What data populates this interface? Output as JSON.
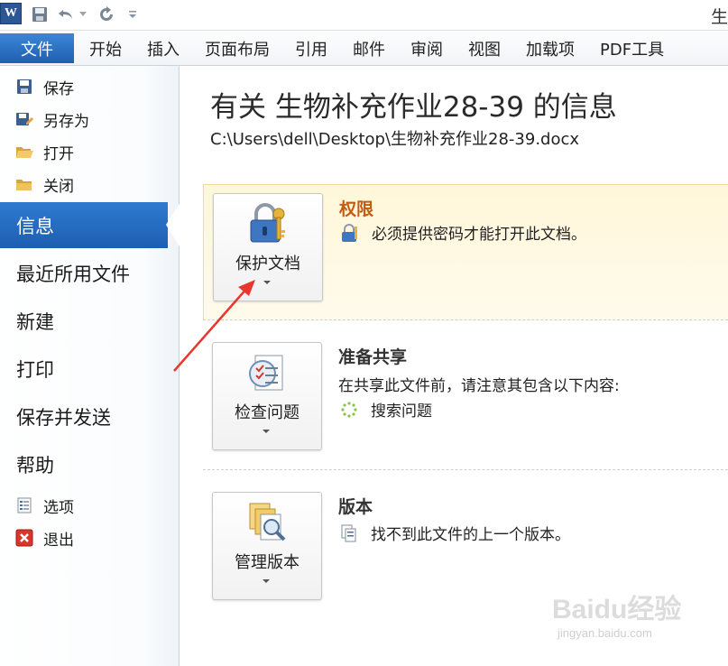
{
  "titlebar": {
    "app_logo": "W",
    "title_fragment": "生",
    "icons": [
      "word-logo-icon",
      "save-icon",
      "undo-icon",
      "redo-icon",
      "customize-icon"
    ]
  },
  "ribbon": {
    "file_tab": "文件",
    "tabs": [
      "开始",
      "插入",
      "页面布局",
      "引用",
      "邮件",
      "审阅",
      "视图",
      "加载项",
      "PDF工具"
    ]
  },
  "sidebar": {
    "commands_top": [
      {
        "label": "保存",
        "icon": "save-icon"
      },
      {
        "label": "另存为",
        "icon": "save-as-icon"
      },
      {
        "label": "打开",
        "icon": "open-folder-icon"
      },
      {
        "label": "关闭",
        "icon": "close-folder-icon"
      }
    ],
    "nav": [
      "信息",
      "最近所用文件",
      "新建",
      "打印",
      "保存并发送",
      "帮助"
    ],
    "selected": "信息",
    "commands_bottom": [
      {
        "label": "选项",
        "icon": "options-icon"
      },
      {
        "label": "退出",
        "icon": "exit-icon"
      }
    ]
  },
  "main": {
    "title": "有关 生物补充作业28-39 的信息",
    "path": "C:\\Users\\dell\\Desktop\\生物补充作业28-39.docx",
    "sections": [
      {
        "button_label": "保护文档",
        "button_icon": "lock-key-icon",
        "heading": "权限",
        "heading_color": "#c55a11",
        "lines": [
          {
            "icon": "lock-small-icon",
            "text": "必须提供密码才能打开此文档。"
          }
        ]
      },
      {
        "button_label": "检查问题",
        "button_icon": "checklist-icon",
        "heading": "准备共享",
        "heading_color": "#333333",
        "lines": [
          {
            "icon": "",
            "text": "在共享此文件前，请注意其包含以下内容:"
          },
          {
            "icon": "spinner-icon",
            "text": "搜索问题"
          }
        ]
      },
      {
        "button_label": "管理版本",
        "button_icon": "versions-icon",
        "heading": "版本",
        "heading_color": "#333333",
        "lines": [
          {
            "icon": "document-small-icon",
            "text": "找不到此文件的上一个版本。"
          }
        ]
      }
    ]
  },
  "colors": {
    "file_tab": "#2b6cc4",
    "selected_nav": "#2567bf",
    "arrow": "#e8372f"
  },
  "watermark": {
    "brand": "Baidu经验",
    "url": "jingyan.baidu.com"
  }
}
